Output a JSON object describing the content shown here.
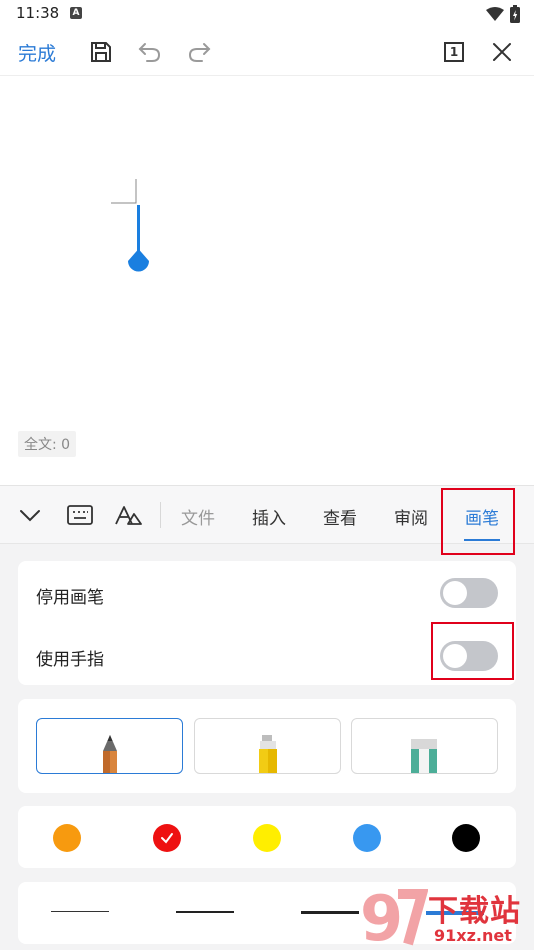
{
  "status_bar": {
    "time": "11:38",
    "notification_letter": "A"
  },
  "toolbar": {
    "done_label": "完成",
    "page_count": "1"
  },
  "document": {
    "word_count": "全文: 0"
  },
  "tabs": [
    {
      "label": "文件",
      "state": "muted"
    },
    {
      "label": "插入",
      "state": "normal"
    },
    {
      "label": "查看",
      "state": "normal"
    },
    {
      "label": "审阅",
      "state": "normal"
    },
    {
      "label": "画笔",
      "state": "active"
    }
  ],
  "pen_settings": {
    "disable_pen_label": "停用画笔",
    "disable_pen_on": false,
    "use_finger_label": "使用手指",
    "use_finger_on": false
  },
  "pen_types": [
    {
      "name": "pencil",
      "selected": true
    },
    {
      "name": "highlighter",
      "selected": false
    },
    {
      "name": "eraser",
      "selected": false
    }
  ],
  "colors": [
    {
      "hex": "#f79a0f",
      "selected": false
    },
    {
      "hex": "#ee1111",
      "selected": true
    },
    {
      "hex": "#ffee00",
      "selected": false
    },
    {
      "hex": "#3898f0",
      "selected": false
    },
    {
      "hex": "#000000",
      "selected": false
    }
  ],
  "accent_color": "#2b7bd6",
  "highlight_color": "#e0001b",
  "watermark": {
    "brand": "下载站",
    "url": "91xz.net",
    "logo_digits": "9"
  }
}
